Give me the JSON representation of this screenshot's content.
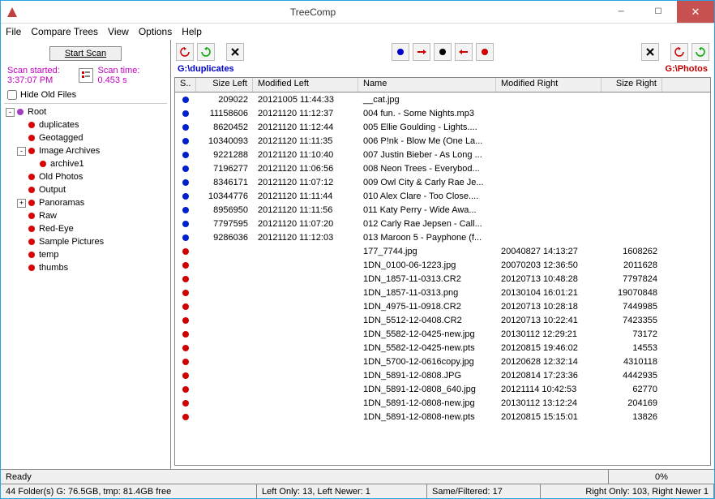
{
  "window": {
    "title": "TreeComp"
  },
  "menu": [
    "File",
    "Compare Trees",
    "View",
    "Options",
    "Help"
  ],
  "scan": {
    "button": "Start Scan",
    "started_label": "Scan started:",
    "started_value": "3:37:07 PM",
    "time_label": "Scan time:",
    "time_value": "0.453 s",
    "hide_old": "Hide Old Files"
  },
  "tree": [
    {
      "depth": 0,
      "toggle": "-",
      "dot": "purple",
      "label": "Root"
    },
    {
      "depth": 1,
      "dot": "red",
      "label": "duplicates"
    },
    {
      "depth": 1,
      "dot": "red",
      "label": "Geotagged"
    },
    {
      "depth": 1,
      "toggle": "-",
      "dot": "red",
      "label": "Image Archives"
    },
    {
      "depth": 2,
      "dot": "red",
      "label": "archive1"
    },
    {
      "depth": 1,
      "dot": "red",
      "label": "Old Photos"
    },
    {
      "depth": 1,
      "dot": "red",
      "label": "Output"
    },
    {
      "depth": 1,
      "toggle": "+",
      "dot": "red",
      "label": "Panoramas"
    },
    {
      "depth": 1,
      "dot": "red",
      "label": "Raw"
    },
    {
      "depth": 1,
      "dot": "red",
      "label": "Red-Eye"
    },
    {
      "depth": 1,
      "dot": "red",
      "label": "Sample Pictures"
    },
    {
      "depth": 1,
      "dot": "red",
      "label": "temp"
    },
    {
      "depth": 1,
      "dot": "red",
      "label": "thumbs"
    }
  ],
  "paths": {
    "left": "G:\\duplicates",
    "right": "G:\\Photos"
  },
  "columns": {
    "s": "S..",
    "sl": "Size Left",
    "ml": "Modified Left",
    "nm": "Name",
    "mr": "Modified Right",
    "sr": "Size Right"
  },
  "rows": [
    {
      "dot": "blue",
      "sl": "209022",
      "ml": "20121005 11:44:33",
      "nm": "__cat.jpg",
      "mr": "",
      "sr": ""
    },
    {
      "dot": "blue",
      "sl": "11158606",
      "ml": "20121120 11:12:37",
      "nm": "004 fun. - Some Nights.mp3",
      "mr": "",
      "sr": ""
    },
    {
      "dot": "blue",
      "sl": "8620452",
      "ml": "20121120 11:12:44",
      "nm": "005 Ellie Goulding - Lights....",
      "mr": "",
      "sr": ""
    },
    {
      "dot": "blue",
      "sl": "10340093",
      "ml": "20121120 11:11:35",
      "nm": "006 P!nk - Blow Me (One La...",
      "mr": "",
      "sr": ""
    },
    {
      "dot": "blue",
      "sl": "9221288",
      "ml": "20121120 11:10:40",
      "nm": "007 Justin Bieber - As Long ...",
      "mr": "",
      "sr": ""
    },
    {
      "dot": "blue",
      "sl": "7196277",
      "ml": "20121120 11:06:56",
      "nm": "008 Neon Trees - Everybod...",
      "mr": "",
      "sr": ""
    },
    {
      "dot": "blue",
      "sl": "8346171",
      "ml": "20121120 11:07:12",
      "nm": "009 Owl City & Carly Rae Je...",
      "mr": "",
      "sr": ""
    },
    {
      "dot": "blue",
      "sl": "10344776",
      "ml": "20121120 11:11:44",
      "nm": "010 Alex Clare - Too Close....",
      "mr": "",
      "sr": ""
    },
    {
      "dot": "blue",
      "sl": "8956950",
      "ml": "20121120 11:11:56",
      "nm": "011 Katy Perry - Wide Awa...",
      "mr": "",
      "sr": ""
    },
    {
      "dot": "blue",
      "sl": "7797595",
      "ml": "20121120 11:07:20",
      "nm": "012 Carly Rae Jepsen - Call...",
      "mr": "",
      "sr": ""
    },
    {
      "dot": "blue",
      "sl": "9286036",
      "ml": "20121120 11:12:03",
      "nm": "013 Maroon 5 - Payphone (f...",
      "mr": "",
      "sr": ""
    },
    {
      "dot": "red",
      "sl": "",
      "ml": "",
      "nm": "177_7744.jpg",
      "mr": "20040827 14:13:27",
      "sr": "1608262"
    },
    {
      "dot": "red",
      "sl": "",
      "ml": "",
      "nm": "1DN_0100-06-1223.jpg",
      "mr": "20070203 12:36:50",
      "sr": "2011628"
    },
    {
      "dot": "red",
      "sl": "",
      "ml": "",
      "nm": "1DN_1857-11-0313.CR2",
      "mr": "20120713 10:48:28",
      "sr": "7797824"
    },
    {
      "dot": "red",
      "sl": "",
      "ml": "",
      "nm": "1DN_1857-11-0313.png",
      "mr": "20130104 16:01:21",
      "sr": "19070848"
    },
    {
      "dot": "red",
      "sl": "",
      "ml": "",
      "nm": "1DN_4975-11-0918.CR2",
      "mr": "20120713 10:28:18",
      "sr": "7449985"
    },
    {
      "dot": "red",
      "sl": "",
      "ml": "",
      "nm": "1DN_5512-12-0408.CR2",
      "mr": "20120713 10:22:41",
      "sr": "7423355"
    },
    {
      "dot": "red",
      "sl": "",
      "ml": "",
      "nm": "1DN_5582-12-0425-new.jpg",
      "mr": "20130112 12:29:21",
      "sr": "73172"
    },
    {
      "dot": "red",
      "sl": "",
      "ml": "",
      "nm": "1DN_5582-12-0425-new.pts",
      "mr": "20120815 19:46:02",
      "sr": "14553"
    },
    {
      "dot": "red",
      "sl": "",
      "ml": "",
      "nm": "1DN_5700-12-0616copy.jpg",
      "mr": "20120628 12:32:14",
      "sr": "4310118"
    },
    {
      "dot": "red",
      "sl": "",
      "ml": "",
      "nm": "1DN_5891-12-0808.JPG",
      "mr": "20120814 17:23:36",
      "sr": "4442935"
    },
    {
      "dot": "red",
      "sl": "",
      "ml": "",
      "nm": "1DN_5891-12-0808_640.jpg",
      "mr": "20121114 10:42:53",
      "sr": "62770"
    },
    {
      "dot": "red",
      "sl": "",
      "ml": "",
      "nm": "1DN_5891-12-0808-new.jpg",
      "mr": "20130112 13:12:24",
      "sr": "204169"
    },
    {
      "dot": "red",
      "sl": "",
      "ml": "",
      "nm": "1DN_5891-12-0808-new.pts",
      "mr": "20120815 15:15:01",
      "sr": "13826"
    }
  ],
  "status1": {
    "ready": "Ready",
    "pct": "0%"
  },
  "status2": {
    "folders": "44 Folder(s) G: 76.5GB, tmp: 81.4GB free",
    "left": "Left Only: 13, Left Newer: 1",
    "same": "Same/Filtered: 17",
    "right": "Right Only: 103, Right Newer 1"
  }
}
